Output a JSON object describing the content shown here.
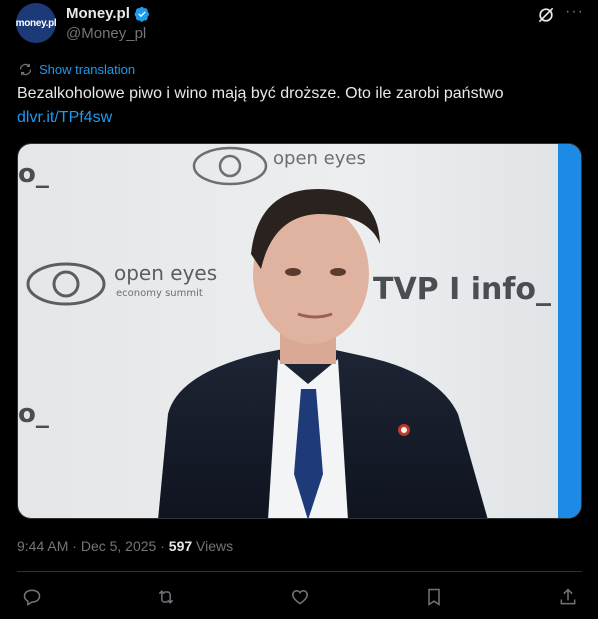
{
  "author": {
    "avatar_text": "money.pl",
    "name": "Money.pl",
    "handle": "@Money_pl",
    "verified_icon": "verified-badge-icon"
  },
  "header": {
    "grok_icon": "grok-icon",
    "more_icon": "more-icon",
    "more_label": "···"
  },
  "translation": {
    "label": "Show translation"
  },
  "tweet": {
    "text": "Bezalkoholowe piwo i wino mają być droższe. Oto ile zarobi państwo",
    "link": "dlvr.it/TPf4sw"
  },
  "media": {
    "brand_text": "open eyes",
    "brand_sub": "economy summit",
    "tvp_text": "TVP I info_"
  },
  "meta": {
    "time": "9:44 AM",
    "separator": "·",
    "date": "Dec 5, 2025",
    "views_count": "597",
    "views_label": "Views"
  },
  "actions": {
    "reply_icon": "reply-icon",
    "repost_icon": "repost-icon",
    "like_icon": "like-icon",
    "bookmark_icon": "bookmark-icon",
    "share_icon": "share-icon"
  },
  "colors": {
    "accent": "#1d9bf0",
    "text": "#e7e9ea",
    "muted": "#71767b",
    "background": "#000000"
  }
}
